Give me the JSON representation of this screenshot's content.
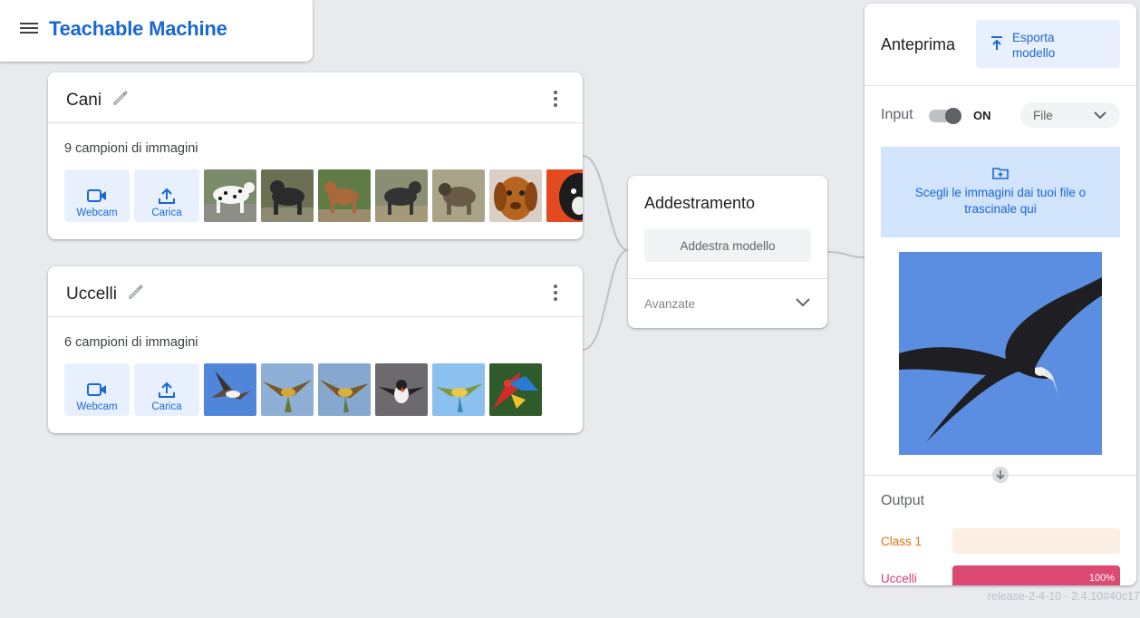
{
  "app": {
    "title": "Teachable Machine"
  },
  "classes": [
    {
      "name": "Cani",
      "sample_count_text": "9 campioni di immagini",
      "webcam_label": "Webcam",
      "upload_label": "Carica",
      "thumbnails": [
        "dalmatian",
        "black-dog",
        "brown-dog",
        "black-lab",
        "mastiff",
        "brown-puppy",
        "black-dog-closeup"
      ]
    },
    {
      "name": "Uccelli",
      "sample_count_text": "6 campioni di immagini",
      "webcam_label": "Webcam",
      "upload_label": "Carica",
      "thumbnails": [
        "osprey",
        "bee-eater",
        "bee-eater-2",
        "puffin",
        "bee-eater-3",
        "macaw"
      ]
    }
  ],
  "training": {
    "title": "Addestramento",
    "train_button": "Addestra modello",
    "advanced_label": "Avanzate"
  },
  "preview": {
    "title": "Anteprima",
    "export_button": "Esporta modello",
    "input_label": "Input",
    "toggle_state": "ON",
    "toggle_on": true,
    "source_select": "File",
    "dropzone_text": "Scegli le immagini dai tuoi file o trascinale qui",
    "output_label": "Output",
    "outputs": [
      {
        "name": "Class 1",
        "fraction": 0.0,
        "percent_text": "",
        "color": "#e8710a",
        "bar_bg": "#fdeee4"
      },
      {
        "name": "Uccelli",
        "fraction": 1.0,
        "percent_text": "100%",
        "color": "#d93873",
        "bar_bg": "#f8d7e3",
        "fill": "#dc4a73"
      }
    ]
  },
  "footer": {
    "version": "release-2-4-10 - 2.4.10#40c17"
  },
  "colors": {
    "accent": "#1967d2",
    "accent_light": "#e8f0fe",
    "background": "#e8eaed"
  }
}
